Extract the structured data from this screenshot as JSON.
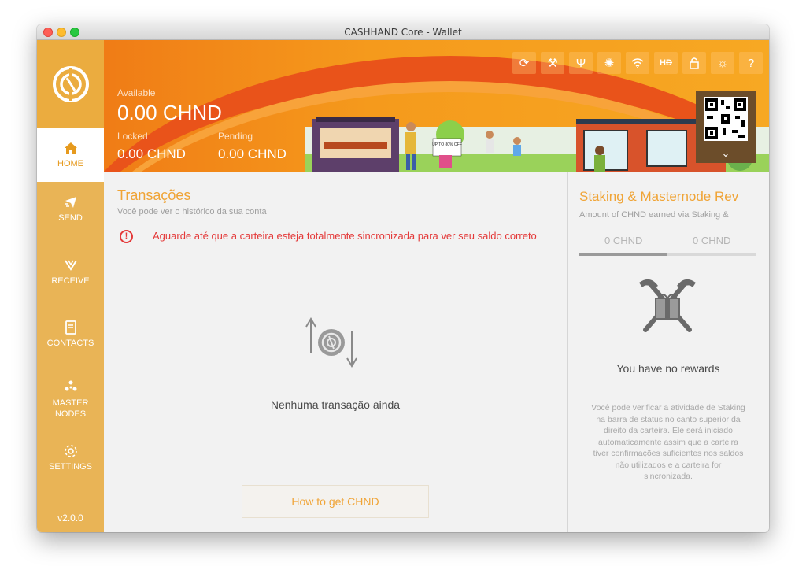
{
  "window": {
    "title": "CASHHAND Core - Wallet"
  },
  "sidebar": {
    "items": [
      {
        "label": "HOME",
        "icon": "home-icon"
      },
      {
        "label": "SEND",
        "icon": "send-icon"
      },
      {
        "label": "RECEIVE",
        "icon": "receive-icon"
      },
      {
        "label": "CONTACTS",
        "icon": "contacts-icon"
      },
      {
        "label": "MASTER\nNODES",
        "line1": "MASTER",
        "line2": "NODES",
        "icon": "masternodes-icon"
      },
      {
        "label": "SETTINGS",
        "icon": "gear-icon"
      }
    ],
    "active": "HOME",
    "version": "v2.0.0"
  },
  "header": {
    "available_label": "Available",
    "available_value": "0.00 CHND",
    "locked_label": "Locked",
    "locked_value": "0.00 CHND",
    "pending_label": "Pending",
    "pending_value": "0.00 CHND",
    "banner_sign": "UP TO 80% OFF",
    "toolbar_icons": [
      "sync-icon",
      "hammer-icon",
      "trident-icon",
      "network-icon",
      "wifi-icon",
      "hd-icon",
      "lock-icon",
      "sun-icon",
      "help-icon"
    ]
  },
  "transactions": {
    "title": "Transações",
    "subtitle": "Você pode ver o histórico da sua conta",
    "warning": "Aguarde até que a carteira esteja totalmente sincronizada para ver seu saldo correto",
    "empty": "Nenhuma transação ainda",
    "how_to_button": "How to get CHND"
  },
  "staking": {
    "title": "Staking & Masternode Rev",
    "subtitle": "Amount of CHND earned via Staking &",
    "value_left": "0 CHND",
    "value_right": "0 CHND",
    "bar_fraction": 0.5,
    "no_rewards": "You have no rewards",
    "description": "Você pode verificar a atividade de Staking na barra de status no canto superior da direito da carteira. Ele será iniciado automaticamente assim que a carteira tiver confirmações suficientes nos saldos não utilizados e a carteira for sincronizada."
  },
  "colors": {
    "accent": "#f0a436",
    "sidebar": "#e9b456",
    "warning": "#e43a3a",
    "header_orange": "#f59a1c"
  }
}
